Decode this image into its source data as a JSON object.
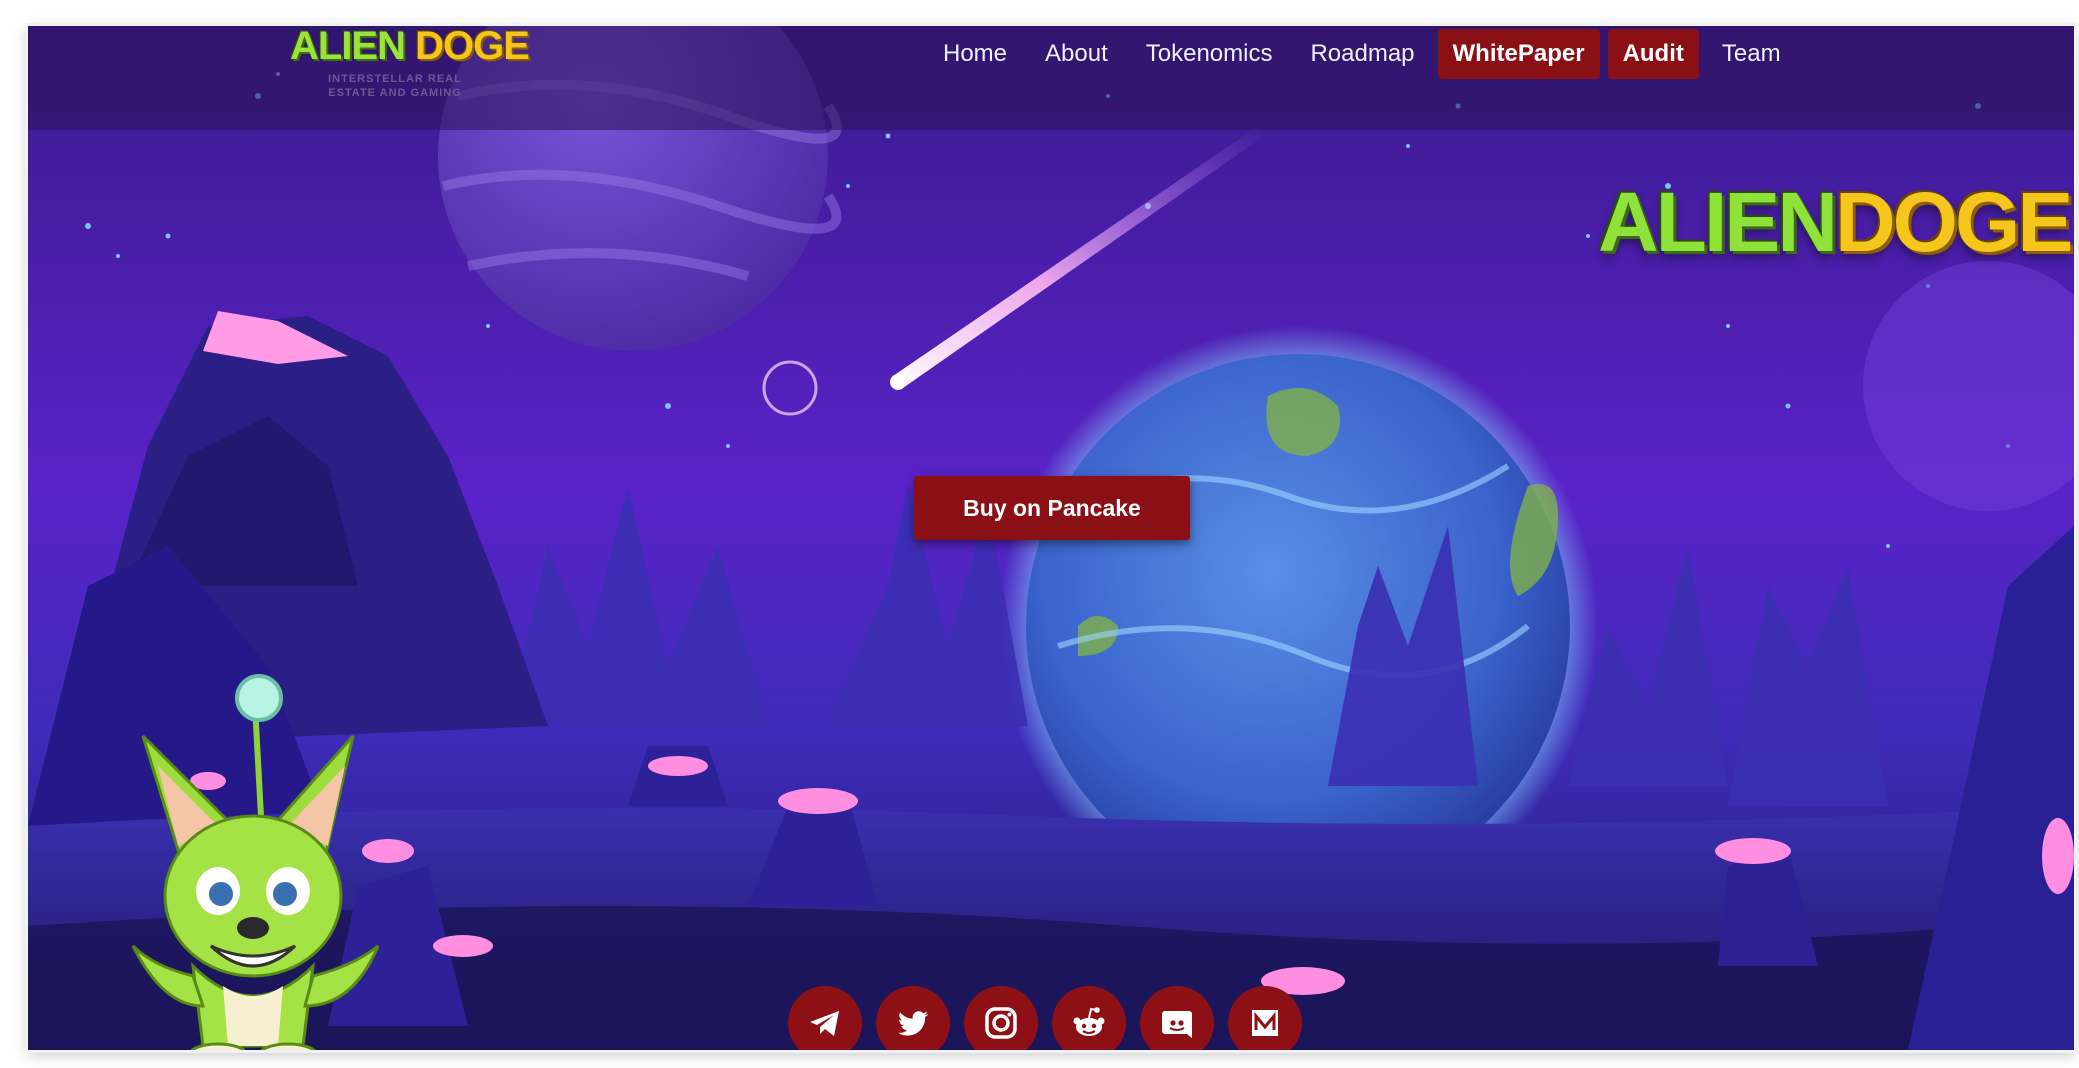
{
  "brand": {
    "name_part1": "ALIEN",
    "name_part2": "DOGE",
    "tagline": "INTERSTELLAR REAL ESTATE AND GAMING"
  },
  "nav": {
    "items": [
      {
        "label": "Home",
        "highlight": false
      },
      {
        "label": "About",
        "highlight": false
      },
      {
        "label": "Tokenomics",
        "highlight": false
      },
      {
        "label": "Roadmap",
        "highlight": false
      },
      {
        "label": "WhitePaper",
        "highlight": true
      },
      {
        "label": "Audit",
        "highlight": true
      },
      {
        "label": "Team",
        "highlight": false
      }
    ]
  },
  "hero": {
    "buy_label": "Buy on Pancake"
  },
  "socials": [
    {
      "icon": "telegram-icon"
    },
    {
      "icon": "twitter-icon"
    },
    {
      "icon": "instagram-icon"
    },
    {
      "icon": "reddit-icon"
    },
    {
      "icon": "discord-icon"
    },
    {
      "icon": "medium-icon"
    }
  ],
  "colors": {
    "button_red": "#8b1016",
    "sky_purple": "#4a1fb6",
    "ground_blue": "#25207a",
    "logo_green": "#8ee23a",
    "logo_yellow": "#f5c71c"
  }
}
